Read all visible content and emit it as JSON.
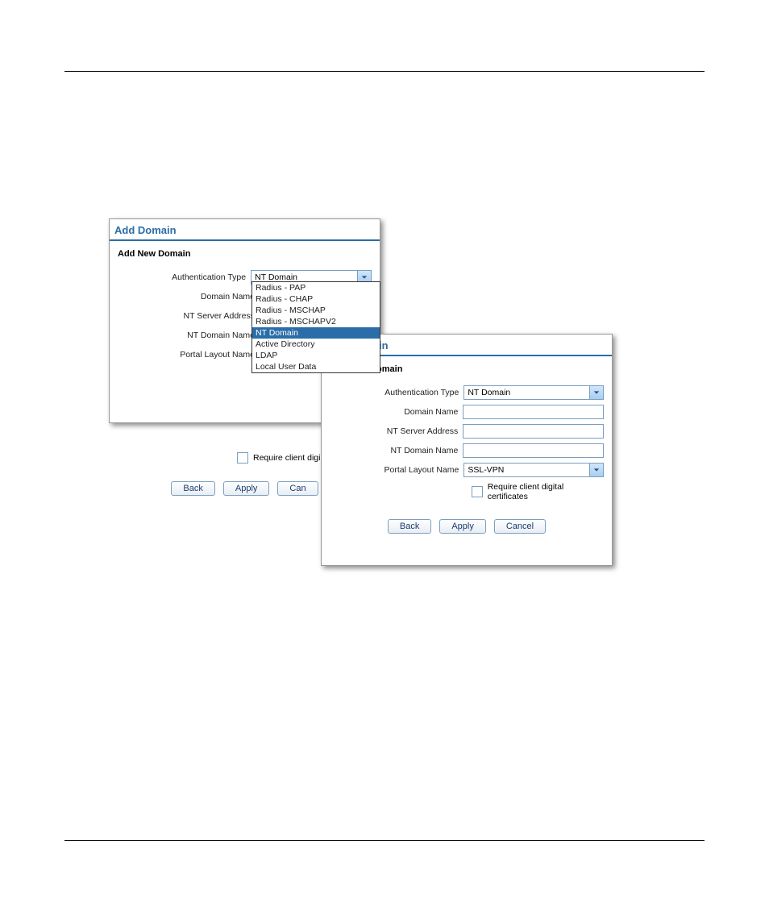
{
  "dialogA": {
    "title": "Add Domain",
    "subtitle": "Add New Domain",
    "labels": {
      "authType": "Authentication Type",
      "domainName": "Domain Name",
      "ntServer": "NT Server Address",
      "ntDomain": "NT Domain Name",
      "portalLayout": "Portal Layout Name"
    },
    "authTypeValue": "NT Domain",
    "dropdownOptions": [
      {
        "label": "Radius - PAP",
        "selected": false
      },
      {
        "label": "Radius - CHAP",
        "selected": false
      },
      {
        "label": "Radius - MSCHAP",
        "selected": false
      },
      {
        "label": "Radius - MSCHAPV2",
        "selected": false
      },
      {
        "label": "NT Domain",
        "selected": true
      },
      {
        "label": "Active Directory",
        "selected": false
      },
      {
        "label": "LDAP",
        "selected": false
      },
      {
        "label": "Local User Data",
        "selected": false
      }
    ],
    "checkbox": "Require client digi",
    "buttons": {
      "back": "Back",
      "apply": "Apply",
      "cancel": "Can"
    }
  },
  "dialogB": {
    "title": "Add Domain",
    "subtitle": "Add New Domain",
    "labels": {
      "authType": "Authentication Type",
      "domainName": "Domain Name",
      "ntServer": "NT Server Address",
      "ntDomain": "NT Domain Name",
      "portalLayout": "Portal Layout Name"
    },
    "authTypeValue": "NT Domain",
    "portalLayoutValue": "SSL-VPN",
    "checkbox": "Require client digital certificates",
    "buttons": {
      "back": "Back",
      "apply": "Apply",
      "cancel": "Cancel"
    }
  }
}
